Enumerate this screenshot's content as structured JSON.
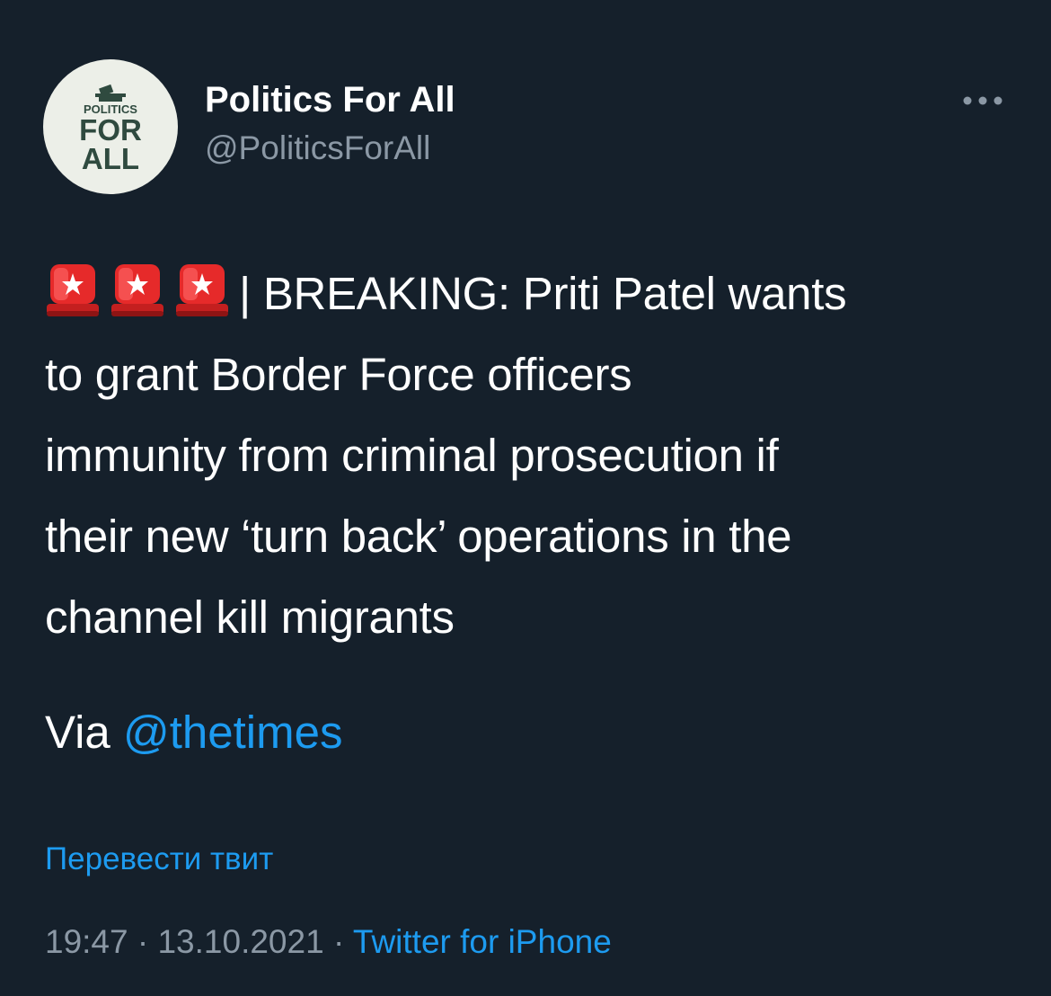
{
  "colors": {
    "background": "#15202b",
    "text_primary": "#ffffff",
    "text_secondary": "#8b98a5",
    "link": "#1d9bf0",
    "avatar_bg": "#ecefe8",
    "avatar_text": "#2f4a3f"
  },
  "author": {
    "avatar_lines": [
      "POLITICS",
      "FOR",
      "ALL"
    ],
    "display_name": "Politics For All",
    "handle": "@PoliticsForAll"
  },
  "menu": {
    "icon": "more-horizontal-icon"
  },
  "tweet": {
    "emoji": [
      "siren-emoji",
      "siren-emoji",
      "siren-emoji"
    ],
    "lines": [
      "| BREAKING: Priti Patel wants",
      "to grant Border Force officers",
      "immunity from criminal prosecution if",
      "their new ‘turn back’ operations in the",
      "channel kill migrants"
    ],
    "via_label": "Via",
    "mention": "@thetimes"
  },
  "translate_label": "Перевести твит",
  "meta": {
    "time": "19:47",
    "separator": " · ",
    "date": "13.10.2021",
    "source": "Twitter for iPhone"
  }
}
